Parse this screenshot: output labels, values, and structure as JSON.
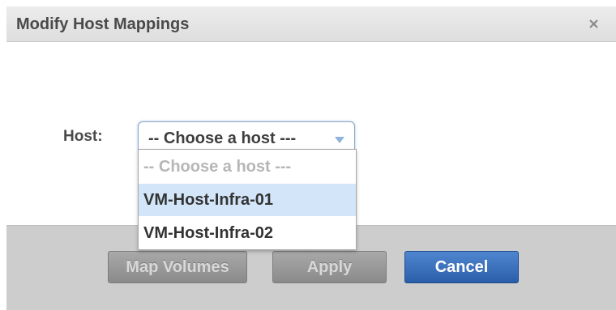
{
  "dialog": {
    "title": "Modify Host Mappings",
    "close_icon": "close-icon"
  },
  "host": {
    "label": "Host:",
    "selected": "-- Choose a host ---",
    "arrow_icon": "chevron-down-icon",
    "options": [
      {
        "label": "-- Choose a host ---"
      },
      {
        "label": "VM-Host-Infra-01"
      },
      {
        "label": "VM-Host-Infra-02"
      }
    ],
    "highlighted_option": "VM-Host-Infra-01"
  },
  "footer": {
    "map_volumes_label": "Map Volumes",
    "apply_label": "Apply",
    "cancel_label": "Cancel"
  },
  "colors": {
    "primary_button": "#2f64ae",
    "highlight": "#d3e6f9",
    "disabled_button": "#9a9a9a"
  }
}
